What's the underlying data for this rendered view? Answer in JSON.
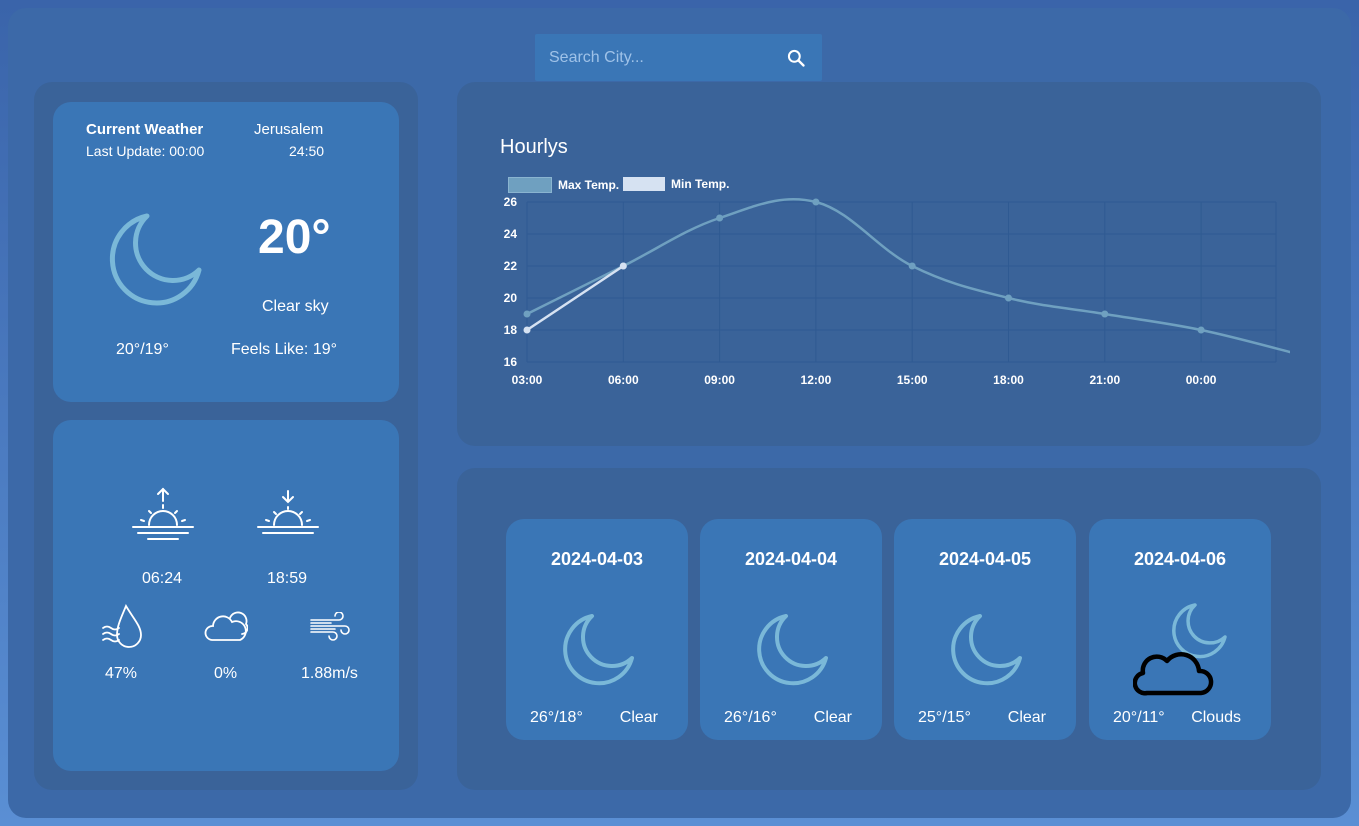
{
  "search": {
    "placeholder": "Search City..."
  },
  "current": {
    "title": "Current Weather",
    "last_update": "Last Update: 00:00",
    "city": "Jerusalem",
    "time": "24:50",
    "temperature": "20°",
    "description": "Clear sky",
    "max_min": "20°/19°",
    "feels_like": "Feels Like: 19°",
    "icon": "moon-icon"
  },
  "details": {
    "sunrise": "06:24",
    "sunset": "18:59",
    "humidity": "47%",
    "clouds": "0%",
    "wind": "1.88m/s"
  },
  "colors": {
    "max_series": "#6fa0c0",
    "min_series": "#d6e2f2",
    "icon_moon": "#7ab8d8"
  },
  "chart_data": {
    "type": "line",
    "title": "Hourlys",
    "categories": [
      "03:00",
      "06:00",
      "09:00",
      "12:00",
      "15:00",
      "18:00",
      "21:00",
      "00:00"
    ],
    "series": [
      {
        "name": "Max Temp.",
        "values": [
          19,
          22,
          25,
          26,
          22,
          20,
          19,
          18,
          16.5
        ]
      },
      {
        "name": "Min Temp.",
        "values": [
          18,
          22
        ]
      }
    ],
    "ylim": [
      16,
      26
    ],
    "yticks": [
      16,
      18,
      20,
      22,
      24,
      26
    ],
    "grid": true,
    "legend": "top-left"
  },
  "forecast": [
    {
      "date": "2024-04-03",
      "temps": "26°/18°",
      "condition": "Clear",
      "icon": "moon-icon"
    },
    {
      "date": "2024-04-04",
      "temps": "26°/16°",
      "condition": "Clear",
      "icon": "moon-icon"
    },
    {
      "date": "2024-04-05",
      "temps": "25°/15°",
      "condition": "Clear",
      "icon": "moon-icon"
    },
    {
      "date": "2024-04-06",
      "temps": "20°/11°",
      "condition": "Clouds",
      "icon": "cloud-moon-icon"
    }
  ]
}
